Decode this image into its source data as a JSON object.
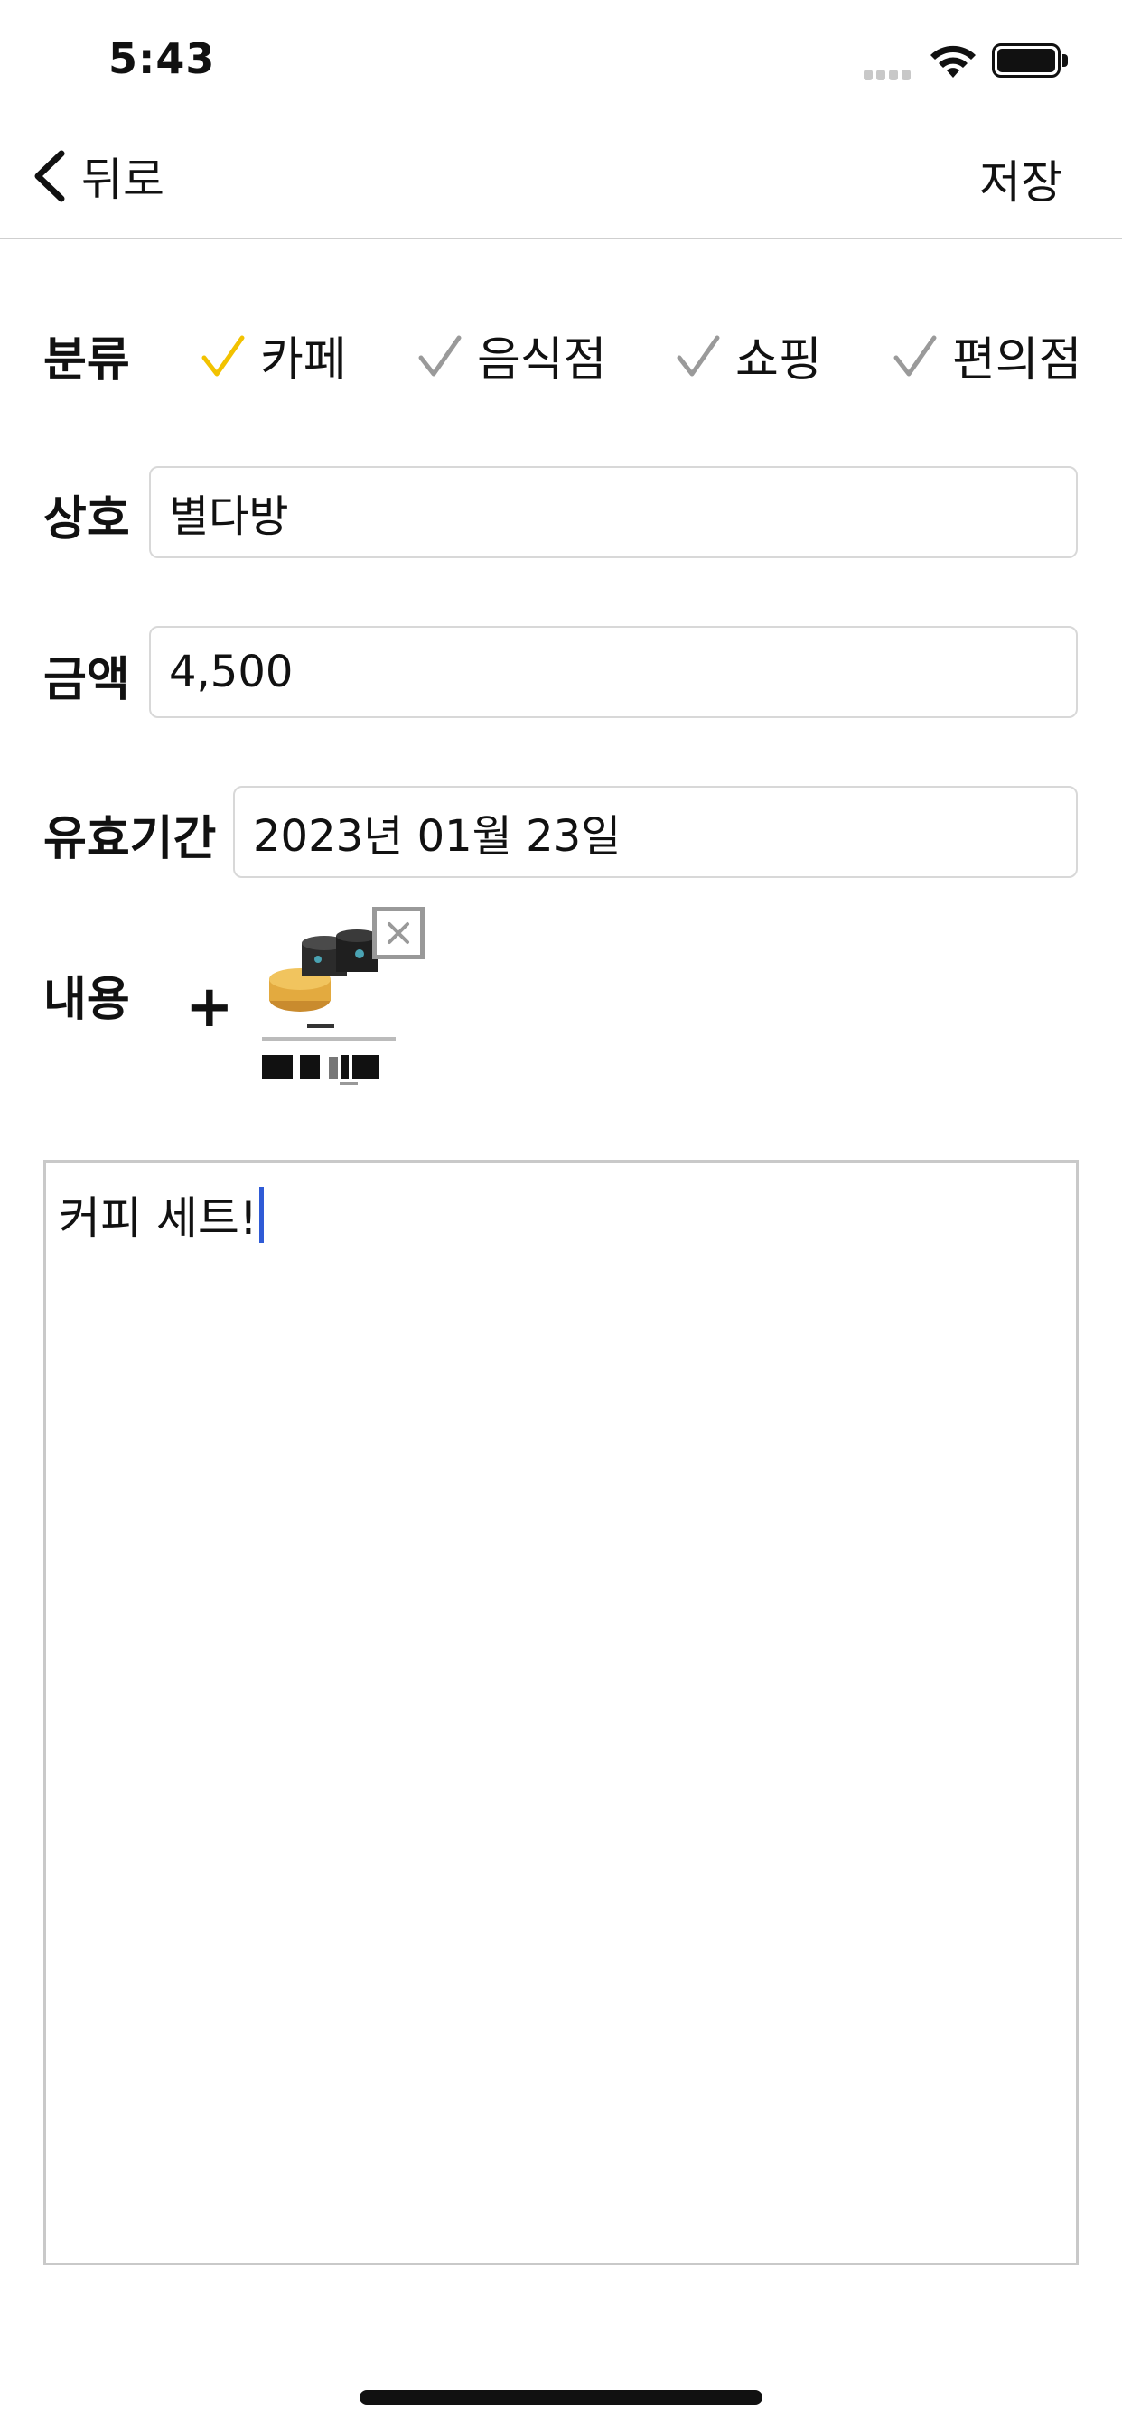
{
  "status_bar": {
    "time": "5:43"
  },
  "nav": {
    "back_label": "뒤로",
    "save_label": "저장"
  },
  "category": {
    "label": "분류",
    "options": [
      {
        "label": "카페",
        "selected": true
      },
      {
        "label": "음식점",
        "selected": false
      },
      {
        "label": "쇼핑",
        "selected": false
      },
      {
        "label": "편의점",
        "selected": false
      }
    ]
  },
  "store": {
    "label": "상호",
    "value": "별다방"
  },
  "amount": {
    "label": "금액",
    "value": "4,500"
  },
  "expiry": {
    "label": "유효기간",
    "value": "2023년 01월 23일"
  },
  "content": {
    "label": "내용",
    "add_symbol": "+",
    "memo": "커피 세트!"
  },
  "colors": {
    "selected_check": "#f2c200",
    "unselected_check": "#9a9a9a",
    "caret": "#2f5bd6"
  }
}
